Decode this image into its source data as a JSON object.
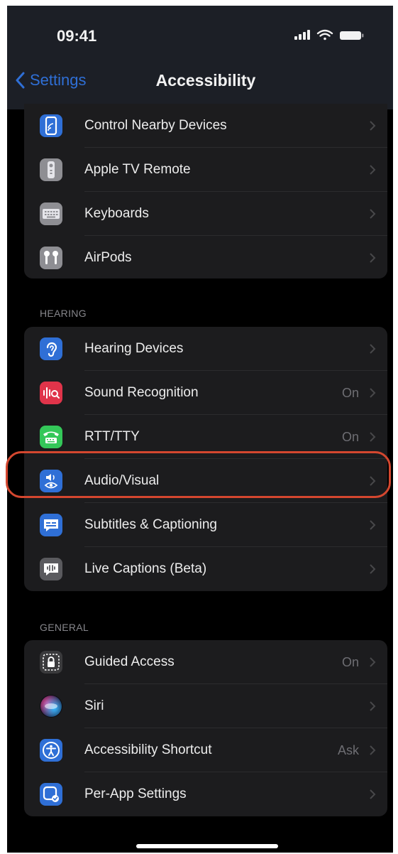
{
  "status_bar": {
    "time": "09:41"
  },
  "nav": {
    "back_label": "Settings",
    "title": "Accessibility"
  },
  "colors": {
    "accent": "#2f6fd6",
    "highlight": "#d4472f",
    "background": "#000000",
    "cell": "#1c1c1e"
  },
  "groups": [
    {
      "header": "",
      "rows": [
        {
          "label": "Control Nearby Devices",
          "value": "",
          "icon": "control-nearby-devices-icon"
        },
        {
          "label": "Apple TV Remote",
          "value": "",
          "icon": "apple-tv-remote-icon"
        },
        {
          "label": "Keyboards",
          "value": "",
          "icon": "keyboard-icon"
        },
        {
          "label": "AirPods",
          "value": "",
          "icon": "airpods-icon"
        }
      ]
    },
    {
      "header": "HEARING",
      "rows": [
        {
          "label": "Hearing Devices",
          "value": "",
          "icon": "ear-icon"
        },
        {
          "label": "Sound Recognition",
          "value": "On",
          "icon": "sound-recognition-icon"
        },
        {
          "label": "RTT/TTY",
          "value": "On",
          "icon": "tty-icon"
        },
        {
          "label": "Audio/Visual",
          "value": "",
          "icon": "audio-visual-icon",
          "highlighted": true
        },
        {
          "label": "Subtitles & Captioning",
          "value": "",
          "icon": "subtitles-icon"
        },
        {
          "label": "Live Captions (Beta)",
          "value": "",
          "icon": "live-captions-icon"
        }
      ]
    },
    {
      "header": "GENERAL",
      "rows": [
        {
          "label": "Guided Access",
          "value": "On",
          "icon": "guided-access-icon"
        },
        {
          "label": "Siri",
          "value": "",
          "icon": "siri-icon"
        },
        {
          "label": "Accessibility Shortcut",
          "value": "Ask",
          "icon": "accessibility-shortcut-icon"
        },
        {
          "label": "Per-App Settings",
          "value": "",
          "icon": "per-app-settings-icon"
        }
      ]
    }
  ]
}
